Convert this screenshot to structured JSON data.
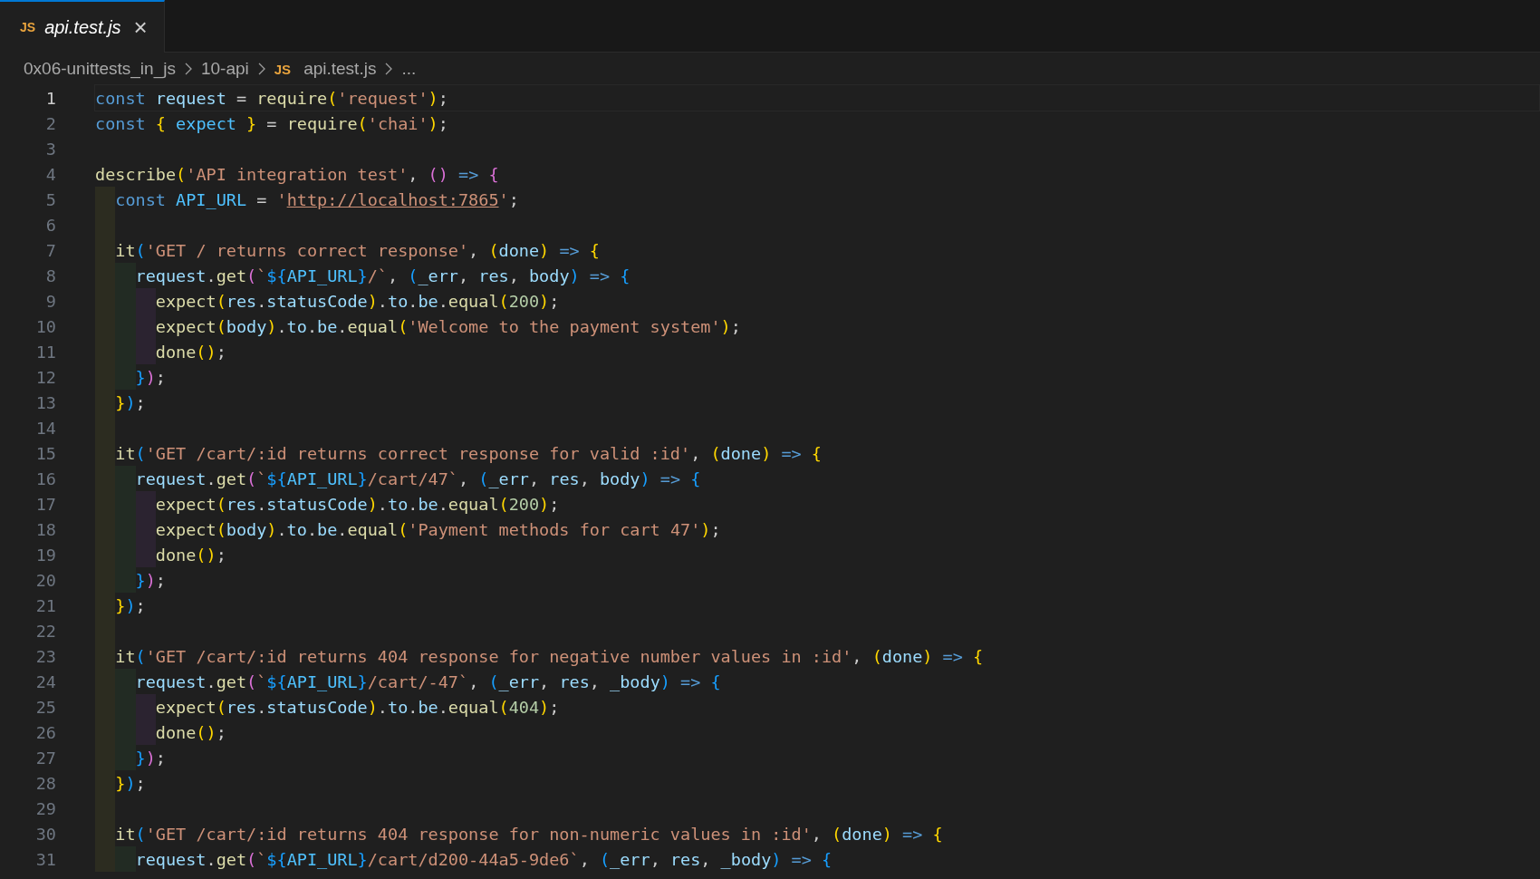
{
  "tabs": [
    {
      "icon": "JS",
      "label": "api.test.js",
      "selected": true,
      "preview": true,
      "close": "×"
    }
  ],
  "breadcrumb": [
    {
      "label": "0x06-unittests_in_js"
    },
    {
      "label": "10-api"
    },
    {
      "icon": "JS",
      "label": "api.test.js"
    },
    {
      "label": "..."
    }
  ],
  "lines": [
    {
      "number": "1",
      "current": true,
      "tokens": [
        {
          "kind": "kw",
          "text": "const "
        },
        {
          "kind": "var",
          "text": "request"
        },
        {
          "kind": "p",
          "text": " = "
        },
        {
          "kind": "fn",
          "text": "require"
        },
        {
          "kind": "b1",
          "text": "("
        },
        {
          "kind": "str",
          "text": "'request'"
        },
        {
          "kind": "b1",
          "text": ")"
        },
        {
          "kind": "p",
          "text": ";"
        }
      ]
    },
    {
      "number": "2",
      "current": false,
      "tokens": [
        {
          "kind": "kw",
          "text": "const "
        },
        {
          "kind": "b1",
          "text": "{ "
        },
        {
          "kind": "con",
          "text": "expect "
        },
        {
          "kind": "b1",
          "text": "}"
        },
        {
          "kind": "p",
          "text": " = "
        },
        {
          "kind": "fn",
          "text": "require"
        },
        {
          "kind": "b1",
          "text": "("
        },
        {
          "kind": "str",
          "text": "'chai'"
        },
        {
          "kind": "b1",
          "text": ")"
        },
        {
          "kind": "p",
          "text": ";"
        }
      ]
    },
    {
      "number": "3",
      "current": false
    },
    {
      "number": "4",
      "current": false,
      "tokens": [
        {
          "kind": "fn",
          "text": "describe"
        },
        {
          "kind": "b1",
          "text": "("
        },
        {
          "kind": "str",
          "text": "'API integration test'"
        },
        {
          "kind": "p",
          "text": ", "
        },
        {
          "kind": "b2",
          "text": "() "
        },
        {
          "kind": "kw",
          "text": "=> "
        },
        {
          "kind": "b2",
          "text": "{"
        }
      ]
    },
    {
      "number": "5",
      "current": false,
      "guides": [
        {
          "color": "#2c2c20"
        }
      ],
      "tokens": [
        {
          "kind": "kw",
          "text": "const "
        },
        {
          "kind": "con",
          "text": "API_URL"
        },
        {
          "kind": "p",
          "text": " = "
        },
        {
          "kind": "str",
          "text": "'"
        },
        {
          "kind": "url",
          "text": "http://localhost:7865"
        },
        {
          "kind": "str",
          "text": "'"
        },
        {
          "kind": "p",
          "text": ";"
        }
      ]
    },
    {
      "number": "6",
      "current": false,
      "guides": [
        {
          "color": "#2c2c20"
        }
      ]
    },
    {
      "number": "7",
      "current": false,
      "guides": [
        {
          "color": "#2c2c20"
        }
      ],
      "tokens": [
        {
          "kind": "fn",
          "text": "it"
        },
        {
          "kind": "b3",
          "text": "("
        },
        {
          "kind": "str",
          "text": "'GET / returns correct response'"
        },
        {
          "kind": "p",
          "text": ", "
        },
        {
          "kind": "b1",
          "text": "("
        },
        {
          "kind": "var",
          "text": "done"
        },
        {
          "kind": "b1",
          "text": ") "
        },
        {
          "kind": "kw",
          "text": "=> "
        },
        {
          "kind": "b1",
          "text": "{"
        }
      ]
    },
    {
      "number": "8",
      "current": false,
      "guides": [
        {
          "color": "#2c2c20"
        },
        {
          "color": "#222b23"
        }
      ],
      "tokens": [
        {
          "kind": "var",
          "text": "request"
        },
        {
          "kind": "p",
          "text": "."
        },
        {
          "kind": "fn",
          "text": "get"
        },
        {
          "kind": "b2",
          "text": "("
        },
        {
          "kind": "str",
          "text": "`"
        },
        {
          "kind": "b3",
          "text": "${"
        },
        {
          "kind": "con",
          "text": "API_URL"
        },
        {
          "kind": "b3",
          "text": "}"
        },
        {
          "kind": "str",
          "text": "/`"
        },
        {
          "kind": "p",
          "text": ", "
        },
        {
          "kind": "b3",
          "text": "("
        },
        {
          "kind": "var",
          "text": "_err"
        },
        {
          "kind": "p",
          "text": ", "
        },
        {
          "kind": "var",
          "text": "res"
        },
        {
          "kind": "p",
          "text": ", "
        },
        {
          "kind": "var",
          "text": "body"
        },
        {
          "kind": "b3",
          "text": ") "
        },
        {
          "kind": "kw",
          "text": "=> "
        },
        {
          "kind": "b3",
          "text": "{"
        }
      ]
    },
    {
      "number": "9",
      "current": false,
      "guides": [
        {
          "color": "#2c2c20"
        },
        {
          "color": "#222b23"
        },
        {
          "color": "#2b2330"
        }
      ],
      "tokens": [
        {
          "kind": "fn",
          "text": "expect"
        },
        {
          "kind": "b1",
          "text": "("
        },
        {
          "kind": "var",
          "text": "res"
        },
        {
          "kind": "p",
          "text": "."
        },
        {
          "kind": "var",
          "text": "statusCode"
        },
        {
          "kind": "b1",
          "text": ")"
        },
        {
          "kind": "p",
          "text": "."
        },
        {
          "kind": "var",
          "text": "to"
        },
        {
          "kind": "p",
          "text": "."
        },
        {
          "kind": "var",
          "text": "be"
        },
        {
          "kind": "p",
          "text": "."
        },
        {
          "kind": "fn",
          "text": "equal"
        },
        {
          "kind": "b1",
          "text": "("
        },
        {
          "kind": "num",
          "text": "200"
        },
        {
          "kind": "b1",
          "text": ")"
        },
        {
          "kind": "p",
          "text": ";"
        }
      ]
    },
    {
      "number": "10",
      "current": false,
      "guides": [
        {
          "color": "#2c2c20"
        },
        {
          "color": "#222b23"
        },
        {
          "color": "#2b2330"
        }
      ],
      "tokens": [
        {
          "kind": "fn",
          "text": "expect"
        },
        {
          "kind": "b1",
          "text": "("
        },
        {
          "kind": "var",
          "text": "body"
        },
        {
          "kind": "b1",
          "text": ")"
        },
        {
          "kind": "p",
          "text": "."
        },
        {
          "kind": "var",
          "text": "to"
        },
        {
          "kind": "p",
          "text": "."
        },
        {
          "kind": "var",
          "text": "be"
        },
        {
          "kind": "p",
          "text": "."
        },
        {
          "kind": "fn",
          "text": "equal"
        },
        {
          "kind": "b1",
          "text": "("
        },
        {
          "kind": "str",
          "text": "'Welcome to the payment system'"
        },
        {
          "kind": "b1",
          "text": ")"
        },
        {
          "kind": "p",
          "text": ";"
        }
      ]
    },
    {
      "number": "11",
      "current": false,
      "guides": [
        {
          "color": "#2c2c20"
        },
        {
          "color": "#222b23"
        },
        {
          "color": "#2b2330"
        }
      ],
      "tokens": [
        {
          "kind": "fn",
          "text": "done"
        },
        {
          "kind": "b1",
          "text": "()"
        },
        {
          "kind": "p",
          "text": ";"
        }
      ]
    },
    {
      "number": "12",
      "current": false,
      "guides": [
        {
          "color": "#2c2c20"
        },
        {
          "color": "#222b23"
        }
      ],
      "tokens": [
        {
          "kind": "b3",
          "text": "}"
        },
        {
          "kind": "b2",
          "text": ")"
        },
        {
          "kind": "p",
          "text": ";"
        }
      ]
    },
    {
      "number": "13",
      "current": false,
      "guides": [
        {
          "color": "#2c2c20"
        }
      ],
      "tokens": [
        {
          "kind": "b1",
          "text": "}"
        },
        {
          "kind": "b3",
          "text": ")"
        },
        {
          "kind": "p",
          "text": ";"
        }
      ]
    },
    {
      "number": "14",
      "current": false,
      "guides": [
        {
          "color": "#2c2c20"
        }
      ]
    },
    {
      "number": "15",
      "current": false,
      "guides": [
        {
          "color": "#2c2c20"
        }
      ],
      "tokens": [
        {
          "kind": "fn",
          "text": "it"
        },
        {
          "kind": "b3",
          "text": "("
        },
        {
          "kind": "str",
          "text": "'GET /cart/:id returns correct response for valid :id'"
        },
        {
          "kind": "p",
          "text": ", "
        },
        {
          "kind": "b1",
          "text": "("
        },
        {
          "kind": "var",
          "text": "done"
        },
        {
          "kind": "b1",
          "text": ") "
        },
        {
          "kind": "kw",
          "text": "=> "
        },
        {
          "kind": "b1",
          "text": "{"
        }
      ]
    },
    {
      "number": "16",
      "current": false,
      "guides": [
        {
          "color": "#2c2c20"
        },
        {
          "color": "#222b23"
        }
      ],
      "tokens": [
        {
          "kind": "var",
          "text": "request"
        },
        {
          "kind": "p",
          "text": "."
        },
        {
          "kind": "fn",
          "text": "get"
        },
        {
          "kind": "b2",
          "text": "("
        },
        {
          "kind": "str",
          "text": "`"
        },
        {
          "kind": "b3",
          "text": "${"
        },
        {
          "kind": "con",
          "text": "API_URL"
        },
        {
          "kind": "b3",
          "text": "}"
        },
        {
          "kind": "str",
          "text": "/cart/47`"
        },
        {
          "kind": "p",
          "text": ", "
        },
        {
          "kind": "b3",
          "text": "("
        },
        {
          "kind": "var",
          "text": "_err"
        },
        {
          "kind": "p",
          "text": ", "
        },
        {
          "kind": "var",
          "text": "res"
        },
        {
          "kind": "p",
          "text": ", "
        },
        {
          "kind": "var",
          "text": "body"
        },
        {
          "kind": "b3",
          "text": ") "
        },
        {
          "kind": "kw",
          "text": "=> "
        },
        {
          "kind": "b3",
          "text": "{"
        }
      ]
    },
    {
      "number": "17",
      "current": false,
      "guides": [
        {
          "color": "#2c2c20"
        },
        {
          "color": "#222b23"
        },
        {
          "color": "#2b2330"
        }
      ],
      "tokens": [
        {
          "kind": "fn",
          "text": "expect"
        },
        {
          "kind": "b1",
          "text": "("
        },
        {
          "kind": "var",
          "text": "res"
        },
        {
          "kind": "p",
          "text": "."
        },
        {
          "kind": "var",
          "text": "statusCode"
        },
        {
          "kind": "b1",
          "text": ")"
        },
        {
          "kind": "p",
          "text": "."
        },
        {
          "kind": "var",
          "text": "to"
        },
        {
          "kind": "p",
          "text": "."
        },
        {
          "kind": "var",
          "text": "be"
        },
        {
          "kind": "p",
          "text": "."
        },
        {
          "kind": "fn",
          "text": "equal"
        },
        {
          "kind": "b1",
          "text": "("
        },
        {
          "kind": "num",
          "text": "200"
        },
        {
          "kind": "b1",
          "text": ")"
        },
        {
          "kind": "p",
          "text": ";"
        }
      ]
    },
    {
      "number": "18",
      "current": false,
      "guides": [
        {
          "color": "#2c2c20"
        },
        {
          "color": "#222b23"
        },
        {
          "color": "#2b2330"
        }
      ],
      "tokens": [
        {
          "kind": "fn",
          "text": "expect"
        },
        {
          "kind": "b1",
          "text": "("
        },
        {
          "kind": "var",
          "text": "body"
        },
        {
          "kind": "b1",
          "text": ")"
        },
        {
          "kind": "p",
          "text": "."
        },
        {
          "kind": "var",
          "text": "to"
        },
        {
          "kind": "p",
          "text": "."
        },
        {
          "kind": "var",
          "text": "be"
        },
        {
          "kind": "p",
          "text": "."
        },
        {
          "kind": "fn",
          "text": "equal"
        },
        {
          "kind": "b1",
          "text": "("
        },
        {
          "kind": "str",
          "text": "'Payment methods for cart 47'"
        },
        {
          "kind": "b1",
          "text": ")"
        },
        {
          "kind": "p",
          "text": ";"
        }
      ]
    },
    {
      "number": "19",
      "current": false,
      "guides": [
        {
          "color": "#2c2c20"
        },
        {
          "color": "#222b23"
        },
        {
          "color": "#2b2330"
        }
      ],
      "tokens": [
        {
          "kind": "fn",
          "text": "done"
        },
        {
          "kind": "b1",
          "text": "()"
        },
        {
          "kind": "p",
          "text": ";"
        }
      ]
    },
    {
      "number": "20",
      "current": false,
      "guides": [
        {
          "color": "#2c2c20"
        },
        {
          "color": "#222b23"
        }
      ],
      "tokens": [
        {
          "kind": "b3",
          "text": "}"
        },
        {
          "kind": "b2",
          "text": ")"
        },
        {
          "kind": "p",
          "text": ";"
        }
      ]
    },
    {
      "number": "21",
      "current": false,
      "guides": [
        {
          "color": "#2c2c20"
        }
      ],
      "tokens": [
        {
          "kind": "b1",
          "text": "}"
        },
        {
          "kind": "b3",
          "text": ")"
        },
        {
          "kind": "p",
          "text": ";"
        }
      ]
    },
    {
      "number": "22",
      "current": false,
      "guides": [
        {
          "color": "#2c2c20"
        }
      ]
    },
    {
      "number": "23",
      "current": false,
      "guides": [
        {
          "color": "#2c2c20"
        }
      ],
      "tokens": [
        {
          "kind": "fn",
          "text": "it"
        },
        {
          "kind": "b3",
          "text": "("
        },
        {
          "kind": "str",
          "text": "'GET /cart/:id returns 404 response for negative number values in :id'"
        },
        {
          "kind": "p",
          "text": ", "
        },
        {
          "kind": "b1",
          "text": "("
        },
        {
          "kind": "var",
          "text": "done"
        },
        {
          "kind": "b1",
          "text": ") "
        },
        {
          "kind": "kw",
          "text": "=> "
        },
        {
          "kind": "b1",
          "text": "{"
        }
      ]
    },
    {
      "number": "24",
      "current": false,
      "guides": [
        {
          "color": "#2c2c20"
        },
        {
          "color": "#222b23"
        }
      ],
      "tokens": [
        {
          "kind": "var",
          "text": "request"
        },
        {
          "kind": "p",
          "text": "."
        },
        {
          "kind": "fn",
          "text": "get"
        },
        {
          "kind": "b2",
          "text": "("
        },
        {
          "kind": "str",
          "text": "`"
        },
        {
          "kind": "b3",
          "text": "${"
        },
        {
          "kind": "con",
          "text": "API_URL"
        },
        {
          "kind": "b3",
          "text": "}"
        },
        {
          "kind": "str",
          "text": "/cart/-47`"
        },
        {
          "kind": "p",
          "text": ", "
        },
        {
          "kind": "b3",
          "text": "("
        },
        {
          "kind": "var",
          "text": "_err"
        },
        {
          "kind": "p",
          "text": ", "
        },
        {
          "kind": "var",
          "text": "res"
        },
        {
          "kind": "p",
          "text": ", "
        },
        {
          "kind": "var",
          "text": "_body"
        },
        {
          "kind": "b3",
          "text": ") "
        },
        {
          "kind": "kw",
          "text": "=> "
        },
        {
          "kind": "b3",
          "text": "{"
        }
      ]
    },
    {
      "number": "25",
      "current": false,
      "guides": [
        {
          "color": "#2c2c20"
        },
        {
          "color": "#222b23"
        },
        {
          "color": "#2b2330"
        }
      ],
      "tokens": [
        {
          "kind": "fn",
          "text": "expect"
        },
        {
          "kind": "b1",
          "text": "("
        },
        {
          "kind": "var",
          "text": "res"
        },
        {
          "kind": "p",
          "text": "."
        },
        {
          "kind": "var",
          "text": "statusCode"
        },
        {
          "kind": "b1",
          "text": ")"
        },
        {
          "kind": "p",
          "text": "."
        },
        {
          "kind": "var",
          "text": "to"
        },
        {
          "kind": "p",
          "text": "."
        },
        {
          "kind": "var",
          "text": "be"
        },
        {
          "kind": "p",
          "text": "."
        },
        {
          "kind": "fn",
          "text": "equal"
        },
        {
          "kind": "b1",
          "text": "("
        },
        {
          "kind": "num",
          "text": "404"
        },
        {
          "kind": "b1",
          "text": ")"
        },
        {
          "kind": "p",
          "text": ";"
        }
      ]
    },
    {
      "number": "26",
      "current": false,
      "guides": [
        {
          "color": "#2c2c20"
        },
        {
          "color": "#222b23"
        },
        {
          "color": "#2b2330"
        }
      ],
      "tokens": [
        {
          "kind": "fn",
          "text": "done"
        },
        {
          "kind": "b1",
          "text": "()"
        },
        {
          "kind": "p",
          "text": ";"
        }
      ]
    },
    {
      "number": "27",
      "current": false,
      "guides": [
        {
          "color": "#2c2c20"
        },
        {
          "color": "#222b23"
        }
      ],
      "tokens": [
        {
          "kind": "b3",
          "text": "}"
        },
        {
          "kind": "b2",
          "text": ")"
        },
        {
          "kind": "p",
          "text": ";"
        }
      ]
    },
    {
      "number": "28",
      "current": false,
      "guides": [
        {
          "color": "#2c2c20"
        }
      ],
      "tokens": [
        {
          "kind": "b1",
          "text": "}"
        },
        {
          "kind": "b3",
          "text": ")"
        },
        {
          "kind": "p",
          "text": ";"
        }
      ]
    },
    {
      "number": "29",
      "current": false,
      "guides": [
        {
          "color": "#2c2c20"
        }
      ]
    },
    {
      "number": "30",
      "current": false,
      "guides": [
        {
          "color": "#2c2c20"
        }
      ],
      "tokens": [
        {
          "kind": "fn",
          "text": "it"
        },
        {
          "kind": "b3",
          "text": "("
        },
        {
          "kind": "str",
          "text": "'GET /cart/:id returns 404 response for non-numeric values in :id'"
        },
        {
          "kind": "p",
          "text": ", "
        },
        {
          "kind": "b1",
          "text": "("
        },
        {
          "kind": "var",
          "text": "done"
        },
        {
          "kind": "b1",
          "text": ") "
        },
        {
          "kind": "kw",
          "text": "=> "
        },
        {
          "kind": "b1",
          "text": "{"
        }
      ]
    },
    {
      "number": "31",
      "current": false,
      "guides": [
        {
          "color": "#2c2c20"
        },
        {
          "color": "#222b23"
        }
      ],
      "tokens": [
        {
          "kind": "var",
          "text": "request"
        },
        {
          "kind": "p",
          "text": "."
        },
        {
          "kind": "fn",
          "text": "get"
        },
        {
          "kind": "b2",
          "text": "("
        },
        {
          "kind": "str",
          "text": "`"
        },
        {
          "kind": "b3",
          "text": "${"
        },
        {
          "kind": "con",
          "text": "API_URL"
        },
        {
          "kind": "b3",
          "text": "}"
        },
        {
          "kind": "str",
          "text": "/cart/d200-44a5-9de6`"
        },
        {
          "kind": "p",
          "text": ", "
        },
        {
          "kind": "b3",
          "text": "("
        },
        {
          "kind": "var",
          "text": "_err"
        },
        {
          "kind": "p",
          "text": ", "
        },
        {
          "kind": "var",
          "text": "res"
        },
        {
          "kind": "p",
          "text": ", "
        },
        {
          "kind": "var",
          "text": "_body"
        },
        {
          "kind": "b3",
          "text": ") "
        },
        {
          "kind": "kw",
          "text": "=> "
        },
        {
          "kind": "b3",
          "text": "{"
        }
      ]
    }
  ]
}
